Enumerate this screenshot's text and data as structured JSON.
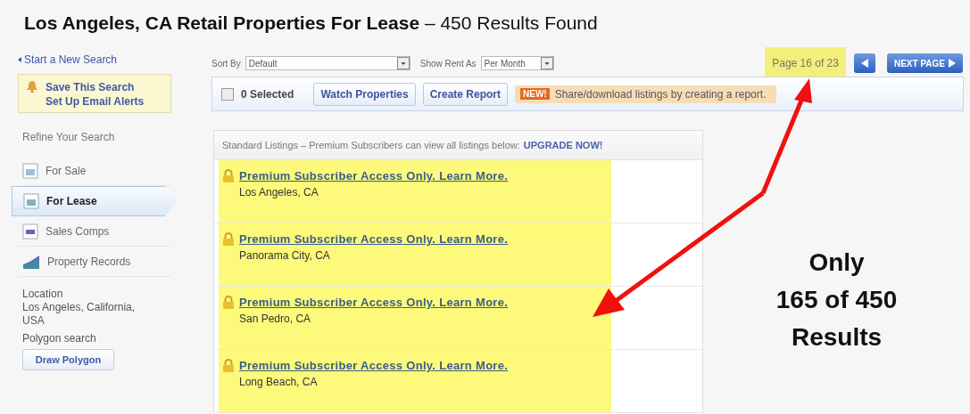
{
  "title": {
    "main": "Los Angeles, CA Retail Properties For Lease",
    "suffix": "– 450 Results Found"
  },
  "sidebar": {
    "new_search": "Start a New Search",
    "save_search": [
      "Save This Search",
      "Set Up Email Alerts"
    ],
    "refine_heading": "Refine Your Search",
    "items": [
      {
        "label": "For Sale",
        "selected": false
      },
      {
        "label": "For Lease",
        "selected": true
      },
      {
        "label": "Sales Comps",
        "selected": false
      },
      {
        "label": "Property Records",
        "selected": false
      }
    ],
    "location_label": "Location",
    "location_value": "Los Angeles, California, USA",
    "polygon_label": "Polygon search",
    "polygon_button": "Draw Polygon"
  },
  "toolbar": {
    "sort_label": "Sort By",
    "sort_value": "Default",
    "rent_label": "Show Rent As",
    "rent_value": "Per Month",
    "page_info": "Page 16 of 23",
    "next_button": "NEXT PAGE"
  },
  "actions": {
    "checked": false,
    "selected_count": "0 Selected",
    "buttons": [
      "Watch Properties",
      "Create Report"
    ],
    "badge": "NEW!",
    "tip": "Share/download listings by creating a report."
  },
  "listings": {
    "header": "Standard Listings – Premium Subscribers can view all listings below:",
    "upgrade": "UPGRADE NOW!",
    "rows": [
      {
        "link": "Premium Subscriber Access Only. Learn More.",
        "location": "Los Angeles, CA"
      },
      {
        "link": "Premium Subscriber Access Only. Learn More.",
        "location": "Panorama City, CA"
      },
      {
        "link": "Premium Subscriber Access Only. Learn More.",
        "location": "San Pedro, CA"
      },
      {
        "link": "Premium Subscriber Access Only. Learn More.",
        "location": "Long Beach, CA"
      }
    ]
  },
  "annotation": {
    "lines": [
      "Only",
      "165 of 450",
      "Results"
    ]
  }
}
